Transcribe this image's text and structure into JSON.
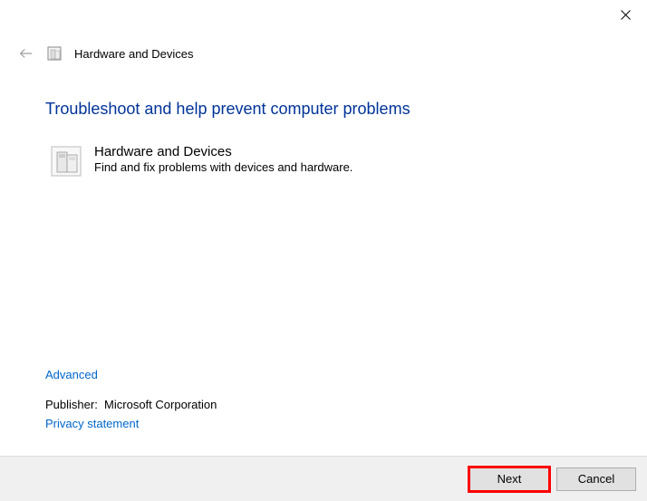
{
  "window": {
    "title": "Hardware and Devices"
  },
  "main": {
    "heading": "Troubleshoot and help prevent computer problems",
    "item": {
      "title": "Hardware and Devices",
      "description": "Find and fix problems with devices and hardware."
    }
  },
  "links": {
    "advanced": "Advanced",
    "privacy": "Privacy statement"
  },
  "publisher": {
    "label": "Publisher:",
    "value": "Microsoft Corporation"
  },
  "buttons": {
    "next": "Next",
    "cancel": "Cancel"
  }
}
